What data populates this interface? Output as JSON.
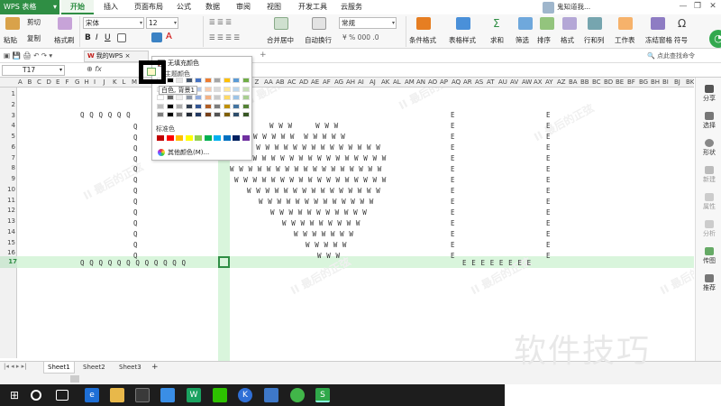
{
  "app": {
    "name": "WPS 表格",
    "dropdown": "▾"
  },
  "tabs": [
    "开始",
    "插入",
    "页面布局",
    "公式",
    "数据",
    "审阅",
    "视图",
    "开发工具",
    "云服务"
  ],
  "user": {
    "name": "鬼知道我..."
  },
  "window": {
    "minimize": "—",
    "restore": "❐",
    "close": "✕"
  },
  "ribbon": {
    "paste": "粘贴",
    "cut": "剪切",
    "copy": "复制",
    "format_painter": "格式刷",
    "font_name": "宋体",
    "font_size": "12",
    "bold": "B",
    "italic": "I",
    "underline": "U",
    "merge_center": "合并居中",
    "wrap_text": "自动换行",
    "number_format": "常规",
    "cond_format": "条件格式",
    "table_style": "表格样式",
    "sum": "求和",
    "filter": "筛选",
    "sort": "排序",
    "format": "格式",
    "rows_cols": "行和列",
    "worksheet": "工作表",
    "freeze": "冻结窗格",
    "symbol": "符号"
  },
  "qa": {
    "doc_tab": "我的WPS",
    "doc_close": "×",
    "hint": "点此查找命令"
  },
  "formula_bar": {
    "name_box": "T17",
    "fx": "fx"
  },
  "columns": [
    "A",
    "B",
    "C",
    "D",
    "E",
    "F",
    "G",
    "H",
    "I",
    "J",
    "K",
    "L",
    "M",
    "N",
    "O",
    "P",
    "Q",
    "R",
    "S",
    "T",
    "U",
    "V",
    "W",
    "X",
    "Y",
    "Z",
    "AA",
    "AB",
    "AC",
    "AD",
    "AE",
    "AF",
    "AG",
    "AH",
    "AI",
    "AJ",
    "AK",
    "AL",
    "AM",
    "AN",
    "AO",
    "AP",
    "AQ",
    "AR",
    "AS",
    "AT",
    "AU",
    "AV",
    "AW",
    "AX",
    "AY",
    "AZ",
    "BA",
    "BB",
    "BC",
    "BD",
    "BE",
    "BF",
    "BG",
    "BH",
    "BI",
    "BJ",
    "BK"
  ],
  "rows": [
    "1",
    "2",
    "3",
    "4",
    "5",
    "6",
    "7",
    "8",
    "9",
    "10",
    "11",
    "12",
    "13",
    "14",
    "15",
    "16",
    "17"
  ],
  "cells": {
    "r3_q": "Q Q Q Q Q Q",
    "q_single": "Q",
    "r17_q": "Q Q Q Q Q Q Q Q Q Q Q Q",
    "r4_w": "W W W     W W W",
    "r5_w": "W W W W W  W W W W W",
    "r6_w": "W W W W W W W W W W W W W W W",
    "r7_w": "W W W W W W W W W W W W W W W W W",
    "r8_w": "W W W W W W W W W W W W W W W W W",
    "r9_w": "W W W W W W W W W W W W W W W W W",
    "r10_w": "W W W W W W W W W W W W W W W",
    "r11_w": "W W W W W W W W W W W W W",
    "r12_w": "W W W W W W W W W W W",
    "r13_w": "W W W W W W W W W",
    "r14_w": "W W W W W W W",
    "r15_w": "W W W W W",
    "r16_w": "W W W",
    "e_single": "E",
    "r17_e": "E E E E E E E E"
  },
  "palette": {
    "no_fill": "无填充颜色",
    "theme_colors": "主题颜色",
    "tooltip": "白色, 背景1",
    "standard_colors": "标准色",
    "more_colors": "其他颜色(M)...",
    "theme_swatches": [
      "#ffffff",
      "#000000",
      "#e7e6e6",
      "#44546a",
      "#4472c4",
      "#ed7d31",
      "#a5a5a5",
      "#ffc000",
      "#5b9bd5",
      "#70ad47"
    ],
    "standard_swatches": [
      "#c00000",
      "#ff0000",
      "#ffc000",
      "#ffff00",
      "#92d050",
      "#00b050",
      "#00b0f0",
      "#0070c0",
      "#002060",
      "#7030a0"
    ]
  },
  "right_panel": [
    "分享",
    "选择",
    "形状",
    "新建",
    "属性",
    "分析",
    "传图",
    "推荐"
  ],
  "sheets": [
    "Sheet1",
    "Sheet2",
    "Sheet3"
  ],
  "sheet_add": "+",
  "watermark": "II 最后的正弦",
  "brand_watermark": "软件技巧",
  "colors": {
    "accent": "#2f8e44",
    "highlight": "#d9f5dc",
    "taskbar": "#1d1d1d"
  }
}
